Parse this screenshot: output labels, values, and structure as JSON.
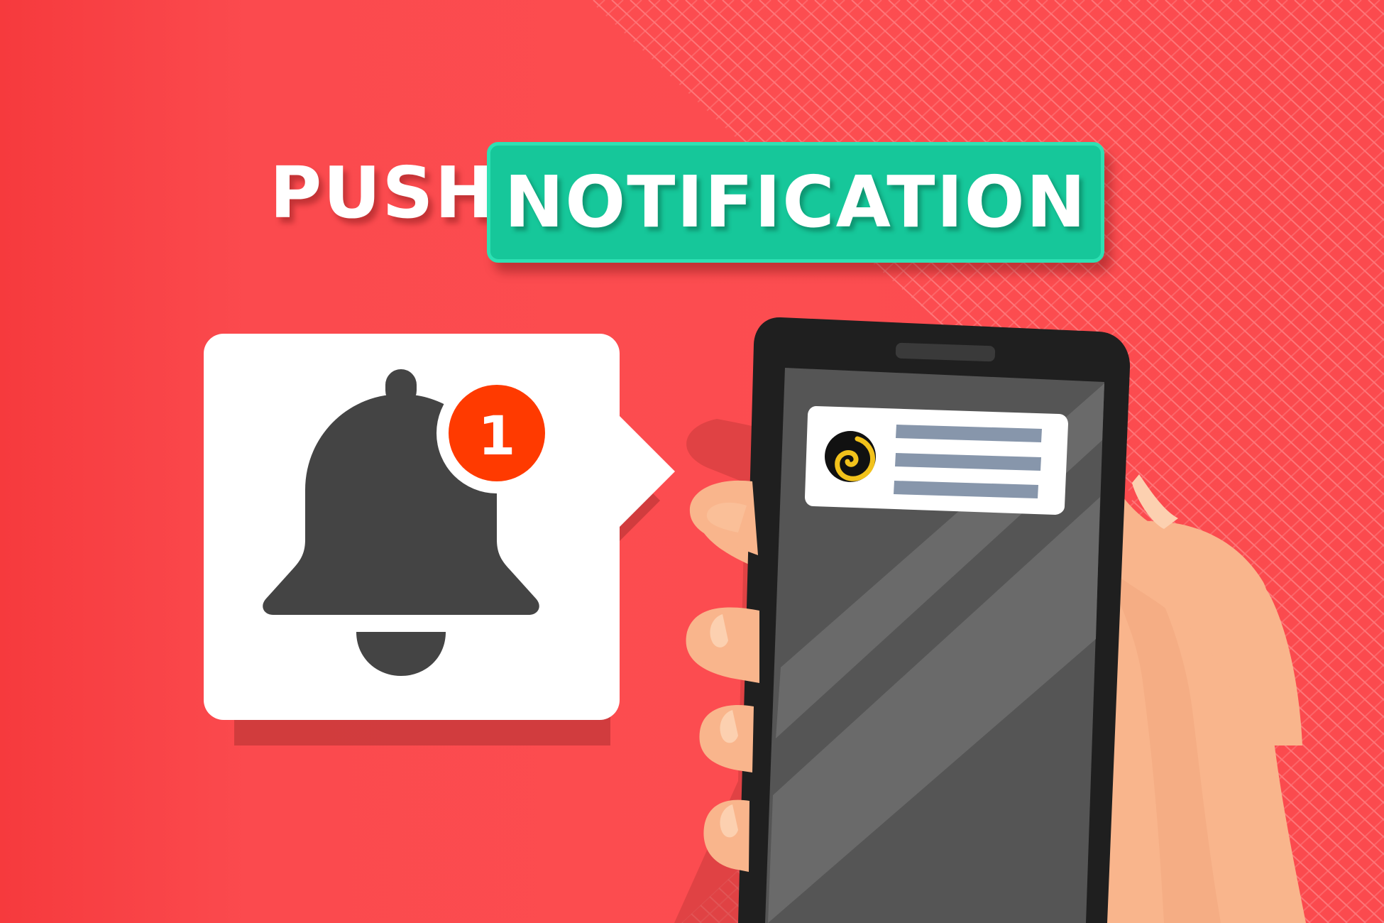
{
  "title": {
    "word1": "PUSH",
    "word2": "NOTIFICATION"
  },
  "bell_card": {
    "icon": "bell-icon",
    "badge_count": "1"
  },
  "phone": {
    "notification": {
      "app_icon": "spiral-logo-icon",
      "text_lines": 3
    }
  },
  "colors": {
    "background": "#fc4d50",
    "accent_green": "#16c79a",
    "badge_red": "#ff3a00",
    "bell_dark": "#444444",
    "phone_body": "#1f1f1f",
    "screen": "#555555",
    "skin": "#f9b58c",
    "notification_line": "#8796ab"
  }
}
